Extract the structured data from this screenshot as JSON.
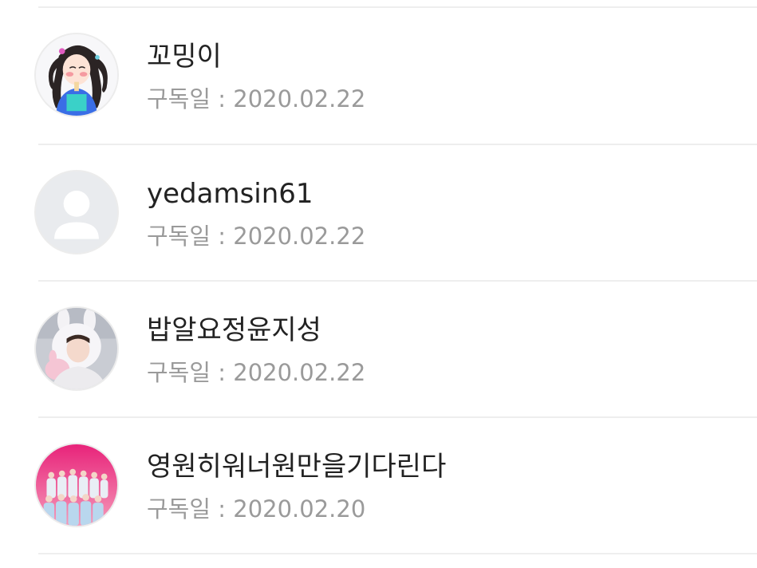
{
  "subscribers": [
    {
      "name": "꼬밍이",
      "date_label": "구독일 : 2020.02.22",
      "avatar": "anime-girl-avatar"
    },
    {
      "name": "yedamsin61",
      "date_label": "구독일 : 2020.02.22",
      "avatar": "default-user-icon"
    },
    {
      "name": "밥알요정윤지성",
      "date_label": "구독일 : 2020.02.22",
      "avatar": "person-bunny-hood-photo"
    },
    {
      "name": "영원히워너원만을기다린다",
      "date_label": "구독일 : 2020.02.20",
      "avatar": "group-photo-pink-background"
    }
  ],
  "colors": {
    "name_text": "#222222",
    "date_text": "#9a9a9a",
    "divider": "#eeeeee",
    "default_avatar_bg": "#e9ebee",
    "default_avatar_fg": "#ffffff"
  }
}
